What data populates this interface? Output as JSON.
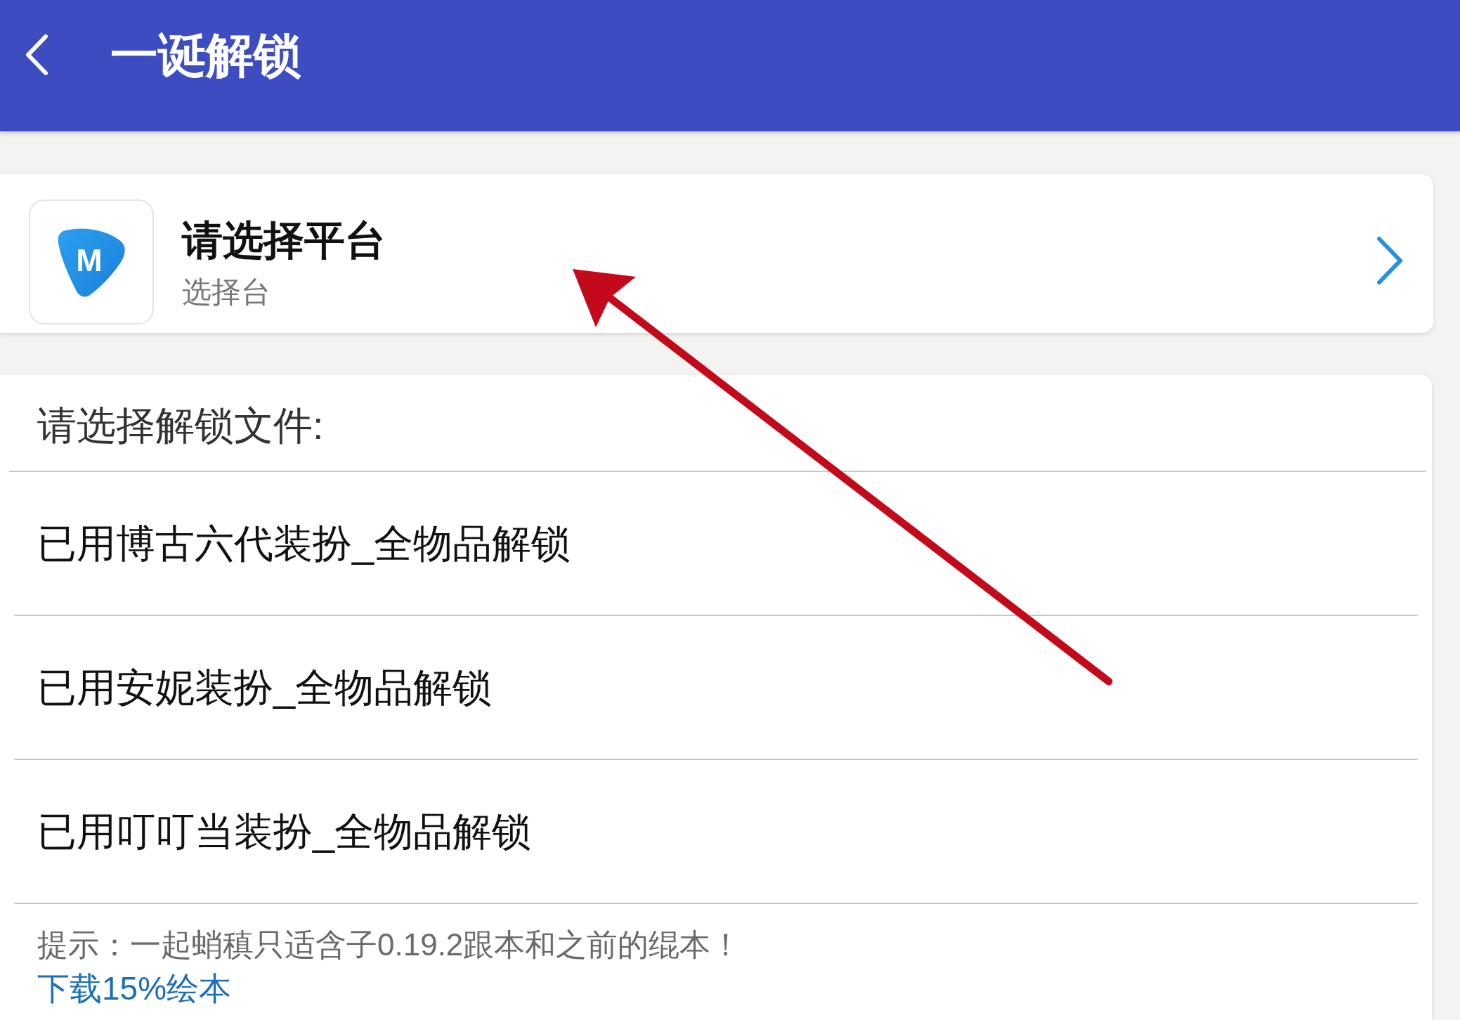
{
  "app_bar": {
    "title": "一诞解锁"
  },
  "platform_card": {
    "logo_letter": "M",
    "title": "请选择平台",
    "subtitle": "选择台"
  },
  "file_list": {
    "heading": "请选择解锁文件:",
    "items": [
      {
        "label": "已用博古六代装扮_全物品解锁"
      },
      {
        "label": "已用安妮装扮_全物品解锁"
      },
      {
        "label": "已用叮叮当装扮_全物品解锁"
      }
    ]
  },
  "hint": {
    "text": "提示：一起蛸稹只适含子0.19.2跟本和之前的绲本！",
    "link": "下载15%绘本"
  }
}
